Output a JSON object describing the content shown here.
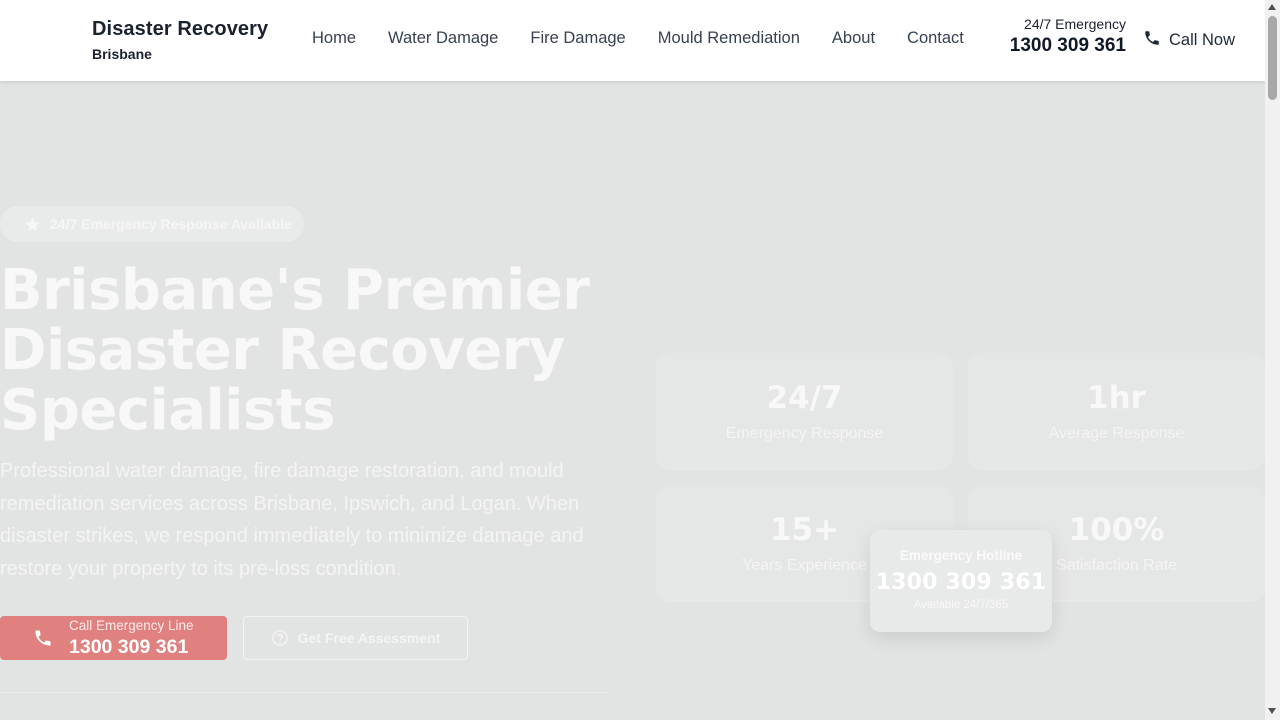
{
  "header": {
    "brand_title": "Disaster Recovery",
    "brand_subtitle": "Brisbane",
    "nav": [
      "Home",
      "Water Damage",
      "Fire Damage",
      "Mould Remediation",
      "About",
      "Contact"
    ],
    "emergency_label": "24/7 Emergency",
    "emergency_number": "1300 309 361",
    "call_now_label": "Call Now",
    "call_icon": "phone-icon"
  },
  "hero": {
    "badge_text": "24/7 Emergency Response Available",
    "badge_icon": "star-icon",
    "title_lines": [
      "Brisbane's Premier",
      "Disaster Recovery",
      "Specialists"
    ],
    "description": "Professional water damage, fire damage restoration, and mould remediation services across Brisbane, Ipswich, and Logan. When disaster strikes, we respond immediately to minimize damage and restore your property to its pre-loss condition.",
    "call_button": {
      "small": "Call Emergency Line",
      "big": "1300 309 361",
      "icon": "phone-icon"
    },
    "assessment_button": {
      "label": "Get Free Assessment",
      "icon": "help-circle-icon"
    },
    "accent_color": "#e0807f"
  },
  "stats": [
    {
      "value": "24/7",
      "label": "Emergency Response"
    },
    {
      "value": "1hr",
      "label": "Average Response"
    },
    {
      "value": "15+",
      "label": "Years Experience"
    },
    {
      "value": "100%",
      "label": "Satisfaction Rate"
    }
  ],
  "hotline": {
    "label": "Emergency Hotline",
    "number": "1300 309 361",
    "availability": "Available 24/7/365"
  }
}
